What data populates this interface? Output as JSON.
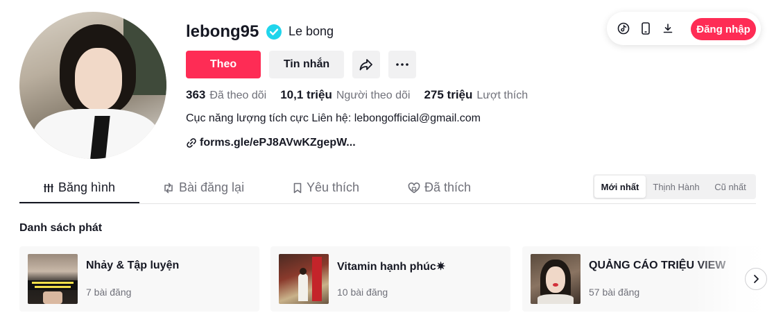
{
  "profile": {
    "username": "lebong95",
    "nickname": "Le bong",
    "verified": true,
    "buttons": {
      "follow": "Theo",
      "message": "Tin nhắn"
    },
    "stats": [
      {
        "value": "363",
        "label": "Đã theo dõi"
      },
      {
        "value": "10,1 triệu",
        "label": "Người theo dõi"
      },
      {
        "value": "275 triệu",
        "label": "Lượt thích"
      }
    ],
    "bio": "Cục năng lượng tích cực Liên hệ: lebongofficial@gmail.com",
    "link": "forms.gle/ePJ8AVwKZgepW..."
  },
  "topbar": {
    "icons": [
      "tiktok-logo-icon",
      "device-icon",
      "download-icon"
    ],
    "login_label": "Đăng nhập"
  },
  "tabs": [
    {
      "label": "Băng hình",
      "icon": "grid-icon",
      "active": true
    },
    {
      "label": "Bài đăng lại",
      "icon": "repost-icon",
      "active": false
    },
    {
      "label": "Yêu thích",
      "icon": "bookmark-icon",
      "active": false
    },
    {
      "label": "Đã thích",
      "icon": "heart-icon",
      "active": false
    }
  ],
  "sort": [
    {
      "label": "Mới nhất",
      "active": true
    },
    {
      "label": "Thịnh Hành",
      "active": false
    },
    {
      "label": "Cũ nhất",
      "active": false
    }
  ],
  "playlists": {
    "title": "Danh sách phát",
    "items": [
      {
        "title": "Nhảy & Tập luyện",
        "count": "7 bài đăng"
      },
      {
        "title": "Vitamin hạnh phúc✷",
        "count": "10 bài đăng"
      },
      {
        "title": "QUẢNG CÁO TRIỆU VIEW",
        "count": "57 bài đăng"
      }
    ]
  },
  "colors": {
    "primary": "#fe2c55",
    "verified": "#20d5ec",
    "text": "#161823",
    "muted": "#6f7079"
  }
}
